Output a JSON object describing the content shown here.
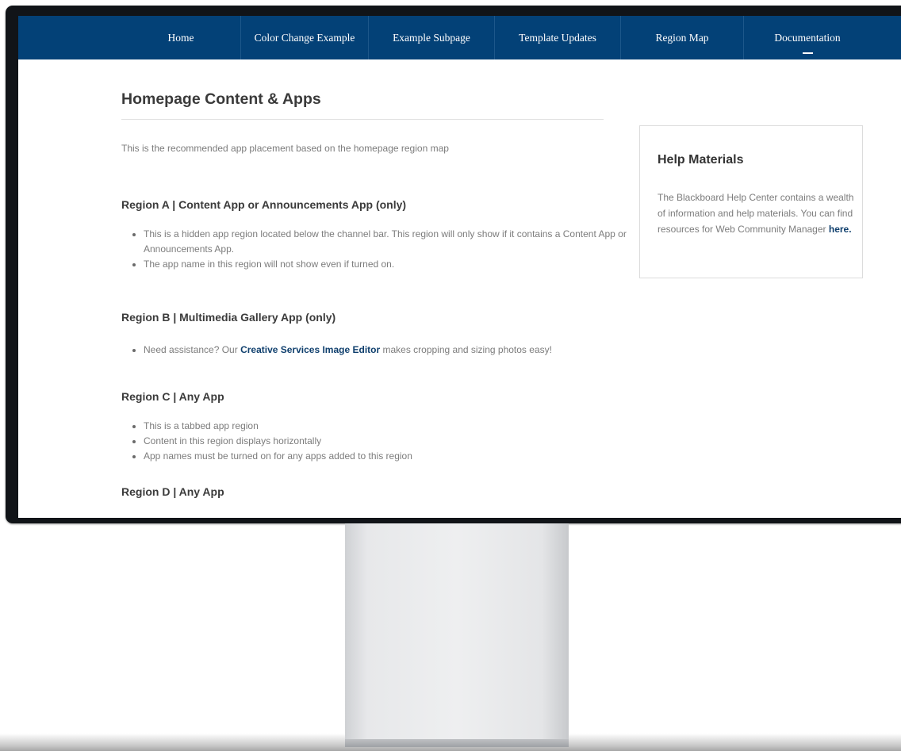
{
  "nav": {
    "items": [
      {
        "label": "Home"
      },
      {
        "label": "Color Change Example"
      },
      {
        "label": "Example Subpage"
      },
      {
        "label": "Template Updates"
      },
      {
        "label": "Region Map"
      },
      {
        "label": "Documentation"
      }
    ]
  },
  "main": {
    "title": "Homepage Content & Apps",
    "intro": "This is the recommended app placement based on the homepage region map",
    "regions": [
      {
        "heading": "Region A | Content App or Announcements App (only)",
        "bullets": [
          "This is a hidden app region located below the channel bar. This region will only show if it contains a Content App or Announcements App.",
          "The app name in this region will not show even if turned on."
        ]
      },
      {
        "heading": "Region B | Multimedia Gallery App (only)",
        "bullets": [
          {
            "prefix": "Need assistance? Our ",
            "link": "Creative Services Image Editor",
            "suffix": " makes cropping and sizing photos easy!"
          }
        ]
      },
      {
        "heading": "Region C | Any App",
        "bullets": [
          "This is a tabbed app region",
          "Content in this region displays horizontally",
          "App names must be turned on for any apps added to this region"
        ]
      },
      {
        "heading": "Region D | Any App",
        "bullets": []
      }
    ]
  },
  "help": {
    "title": "Help Materials",
    "text": "The Blackboard Help Center contains a wealth of information and help materials. You can find resources for Web Community Manager ",
    "link": "here."
  },
  "colors": {
    "nav_bg": "#034177",
    "link": "#0f3f6d"
  }
}
